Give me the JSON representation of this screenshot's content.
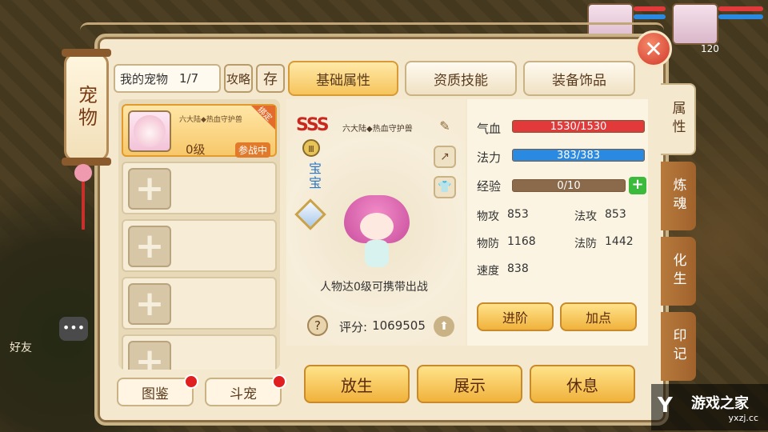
{
  "scroll_title": "宠物",
  "top_right": {
    "level": "120"
  },
  "pet_panel": {
    "name_field": "我的宠物",
    "count": "1/7",
    "strategy_btn": "攻略",
    "store_btn": "存"
  },
  "tabs": [
    "基础属性",
    "资质技能",
    "装备饰品"
  ],
  "pet_slots": [
    {
      "name": "六大陆◆热血守护兽",
      "level": "0级",
      "status": "参战中",
      "corner": "绑定"
    }
  ],
  "bottom_left_buttons": [
    "图鉴",
    "斗宠"
  ],
  "center": {
    "grade": "SSS",
    "title": "六大陆◆热血守护兽",
    "type_label": "宝宝",
    "carry_text": "人物达0级可携带出战",
    "score_label": "评分:",
    "score_value": "1069505"
  },
  "bars": {
    "hp": {
      "label": "气血",
      "value": "1530/1530",
      "fraction": 1.0
    },
    "mp": {
      "label": "法力",
      "value": "383/383",
      "fraction": 1.0
    },
    "exp": {
      "label": "经验",
      "value": "0/10",
      "fraction": 0.0
    }
  },
  "stats": {
    "phys_atk": {
      "label": "物攻",
      "value": "853"
    },
    "mag_atk": {
      "label": "法攻",
      "value": "853"
    },
    "phys_def": {
      "label": "物防",
      "value": "1168"
    },
    "mag_def": {
      "label": "法防",
      "value": "1442"
    },
    "speed": {
      "label": "速度",
      "value": "838"
    }
  },
  "stat_buttons": [
    "进阶",
    "加点"
  ],
  "action_buttons": [
    "放生",
    "展示",
    "休息"
  ],
  "side_tabs": [
    "属性",
    "炼魂",
    "化生",
    "印记"
  ],
  "chat": {
    "friend_label": "好友"
  },
  "watermark": {
    "name": "游戏之家",
    "url": "yxzj.cc"
  },
  "colors": {
    "hp": "#e23a3a",
    "mp": "#2a8ae2",
    "exp": "#8a6a4a",
    "accent": "#f0b23c"
  }
}
